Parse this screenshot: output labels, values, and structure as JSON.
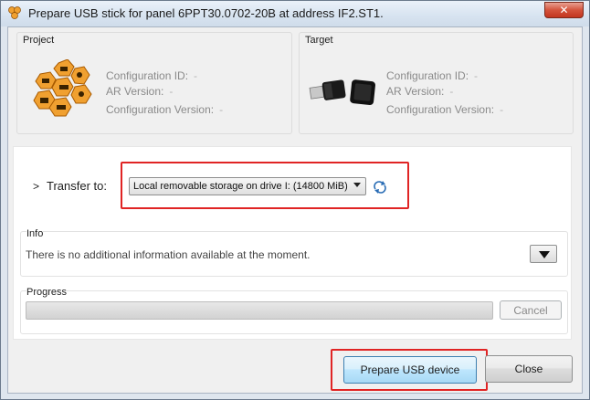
{
  "window": {
    "title": "Prepare USB stick for panel 6PPT30.0702-20B at address IF2.ST1.",
    "close_glyph": "✕"
  },
  "project": {
    "label": "Project",
    "icon": "automation-studio-logo-icon",
    "fields": {
      "config_id": "Configuration ID:",
      "ar_version": "AR Version:",
      "config_version": "Configuration Version:"
    },
    "values": {
      "config_id": "-",
      "ar_version": "-",
      "config_version": "-"
    }
  },
  "target": {
    "label": "Target",
    "icon": "usb-stick-icon",
    "fields": {
      "config_id": "Configuration ID:",
      "ar_version": "AR Version:",
      "config_version": "Configuration Version:"
    },
    "values": {
      "config_id": "-",
      "ar_version": "-",
      "config_version": "-"
    }
  },
  "transfer": {
    "label": "Transfer to:",
    "chevron": ">",
    "selected": "Local removable storage on drive I: (14800 MiB)",
    "refresh_icon": "refresh-icon"
  },
  "info": {
    "label": "Info",
    "message": "There is no additional information available at the moment."
  },
  "progress": {
    "label": "Progress",
    "value": 0,
    "cancel_label": "Cancel"
  },
  "footer": {
    "prepare_label": "Prepare USB device",
    "close_label": "Close"
  },
  "colors": {
    "highlight": "#e02424",
    "logo_orange": "#f0a030"
  }
}
